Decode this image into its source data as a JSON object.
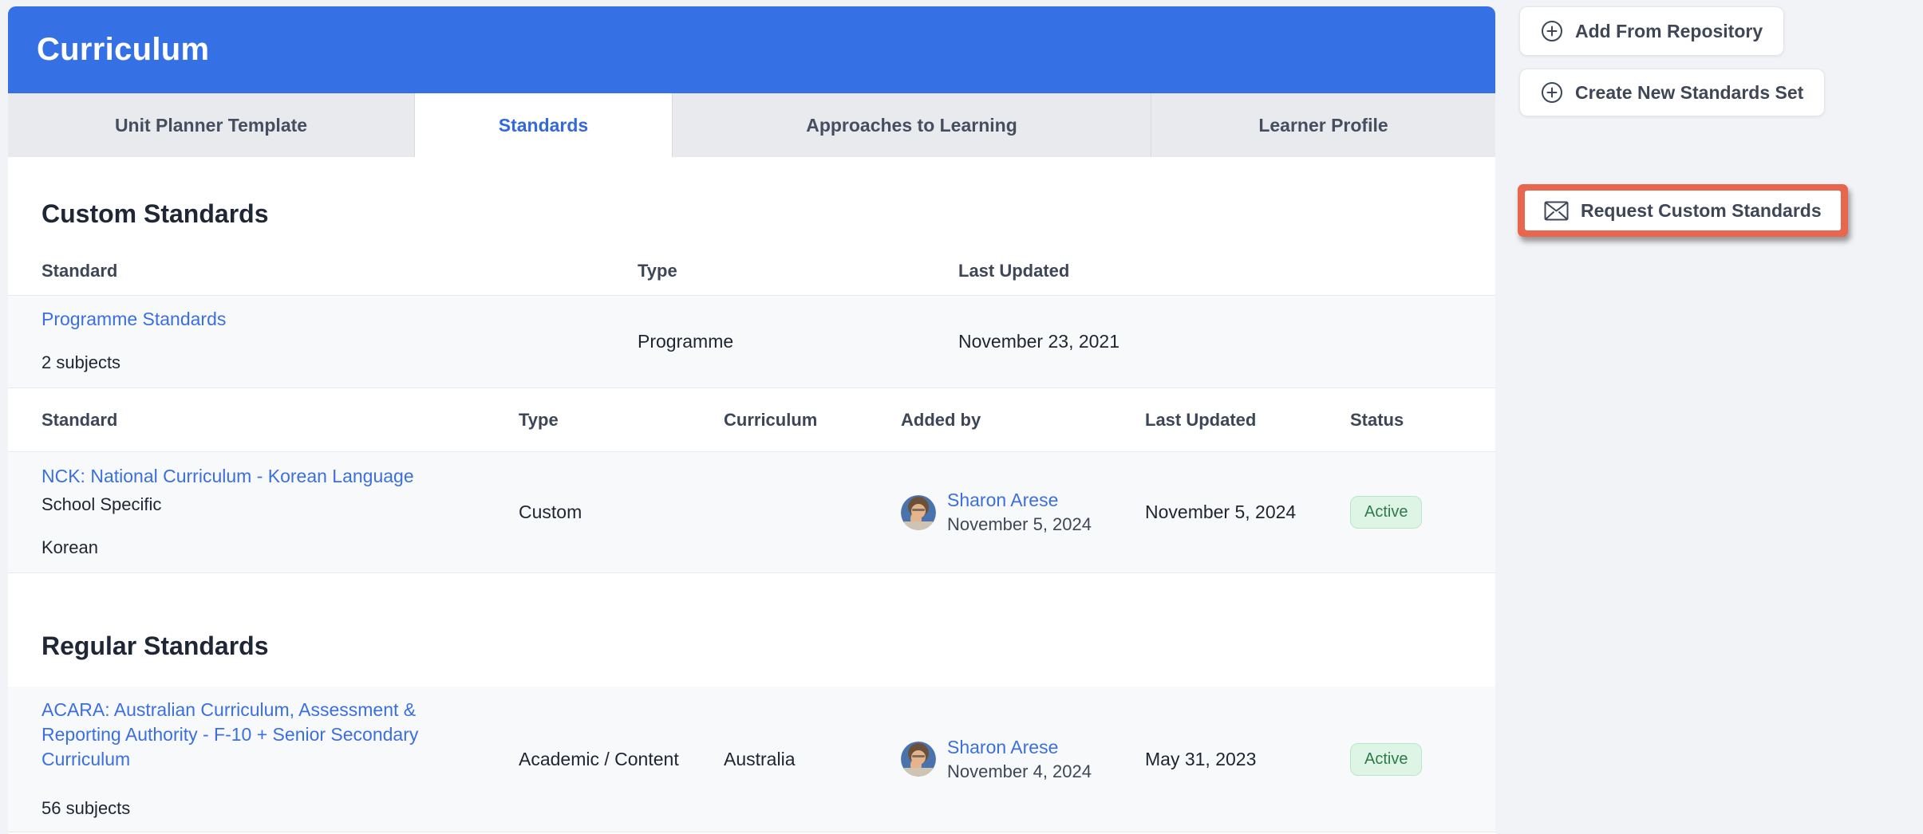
{
  "header": {
    "title": "Curriculum"
  },
  "tabs": [
    {
      "label": "Unit Planner Template",
      "active": false
    },
    {
      "label": "Standards",
      "active": true
    },
    {
      "label": "Approaches to Learning",
      "active": false
    },
    {
      "label": "Learner Profile",
      "active": false
    }
  ],
  "sidebar": {
    "add_from_repository": "Add From Repository",
    "create_new_standards_set": "Create New Standards Set",
    "request_custom_standards": "Request Custom Standards"
  },
  "custom_standards": {
    "heading": "Custom Standards",
    "summary_table": {
      "columns": {
        "standard": "Standard",
        "type": "Type",
        "last_updated": "Last Updated"
      },
      "row": {
        "name": "Programme Standards",
        "subjects": "2 subjects",
        "type": "Programme",
        "last_updated": "November 23, 2021"
      }
    },
    "detail_table": {
      "columns": {
        "standard": "Standard",
        "type": "Type",
        "curriculum": "Curriculum",
        "added_by": "Added by",
        "last_updated": "Last Updated",
        "status": "Status"
      },
      "row": {
        "name": "NCK: National Curriculum - Korean Language",
        "scope": "School Specific",
        "subject": "Korean",
        "type": "Custom",
        "curriculum": "",
        "added_by_name": "Sharon Arese",
        "added_by_date": "November 5, 2024",
        "last_updated": "November 5, 2024",
        "status": "Active"
      }
    }
  },
  "regular_standards": {
    "heading": "Regular Standards",
    "row": {
      "name": "ACARA: Australian Curriculum, Assessment & Reporting Authority - F-10 + Senior Secondary Curriculum",
      "subjects": "56 subjects",
      "type": "Academic / Content",
      "curriculum": "Australia",
      "added_by_name": "Sharon Arese",
      "added_by_date": "November 4, 2024",
      "last_updated": "May 31, 2023",
      "status": "Active"
    }
  },
  "colors": {
    "header_blue": "#3570e4",
    "active_tab_blue": "#3468df",
    "link_blue": "#3b6fe0",
    "badge_green_bg": "#def5e5",
    "badge_green_text": "#2e7a4b",
    "annotation_red": "#e8664e"
  }
}
